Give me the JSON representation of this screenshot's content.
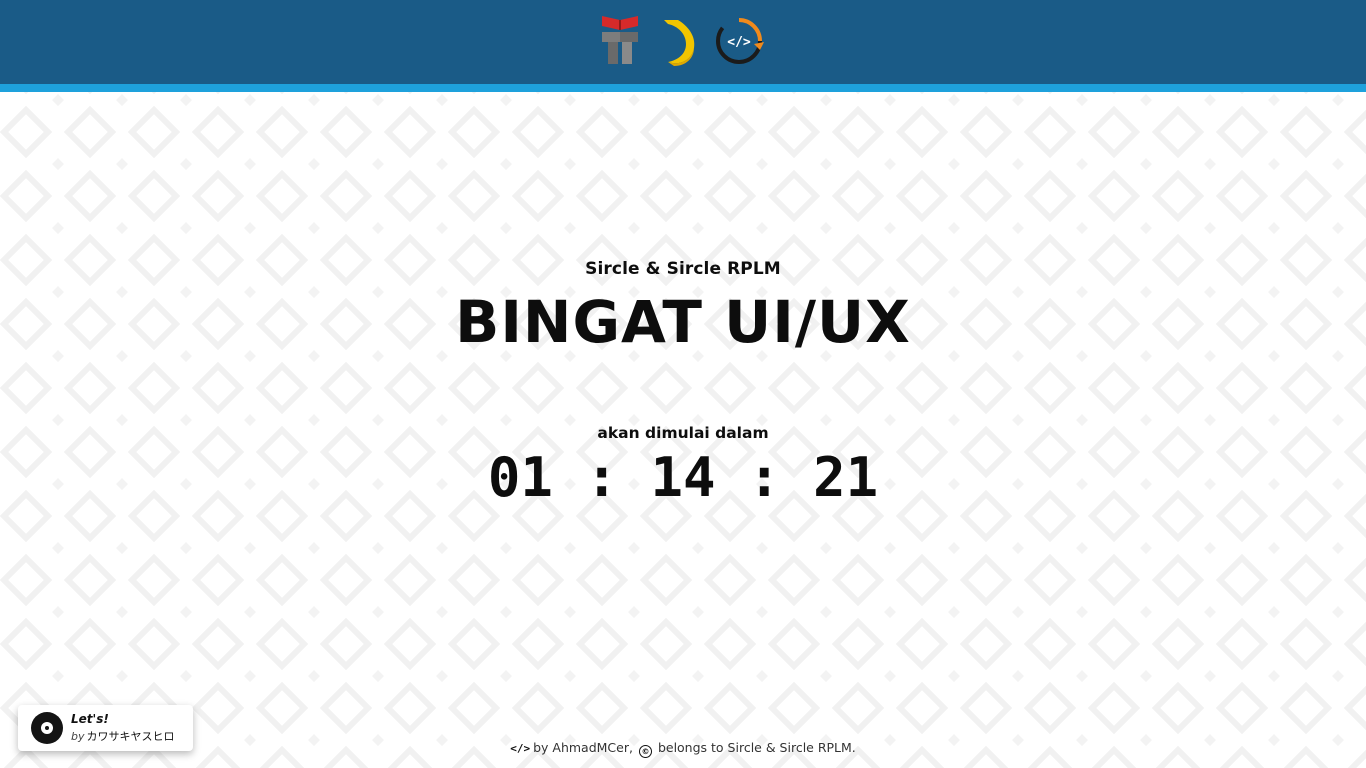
{
  "header": {
    "logos": [
      "kemdikbud-logo",
      "moon-crescent-logo",
      "code-cycle-logo"
    ],
    "colors": {
      "bar": "#1a5b87",
      "stripe": "#1ea1dc"
    }
  },
  "event": {
    "organizer": "Sircle & Sircle RPLM",
    "title": "BINGAT UI/UX",
    "starts_label": "akan dimulai dalam"
  },
  "countdown": {
    "hours": "01",
    "separator": ":",
    "minutes": "14",
    "seconds": "21"
  },
  "footer": {
    "code_icon": "</>",
    "by_text": "by AhmadMCer,",
    "copyright_icon": "©",
    "belongs_text": "belongs to Sircle & Sircle RPLM."
  },
  "music": {
    "title": "Let's!",
    "by_label": "by",
    "artist": "カワサキヤスヒロ",
    "icon": "vinyl-disc-icon"
  }
}
